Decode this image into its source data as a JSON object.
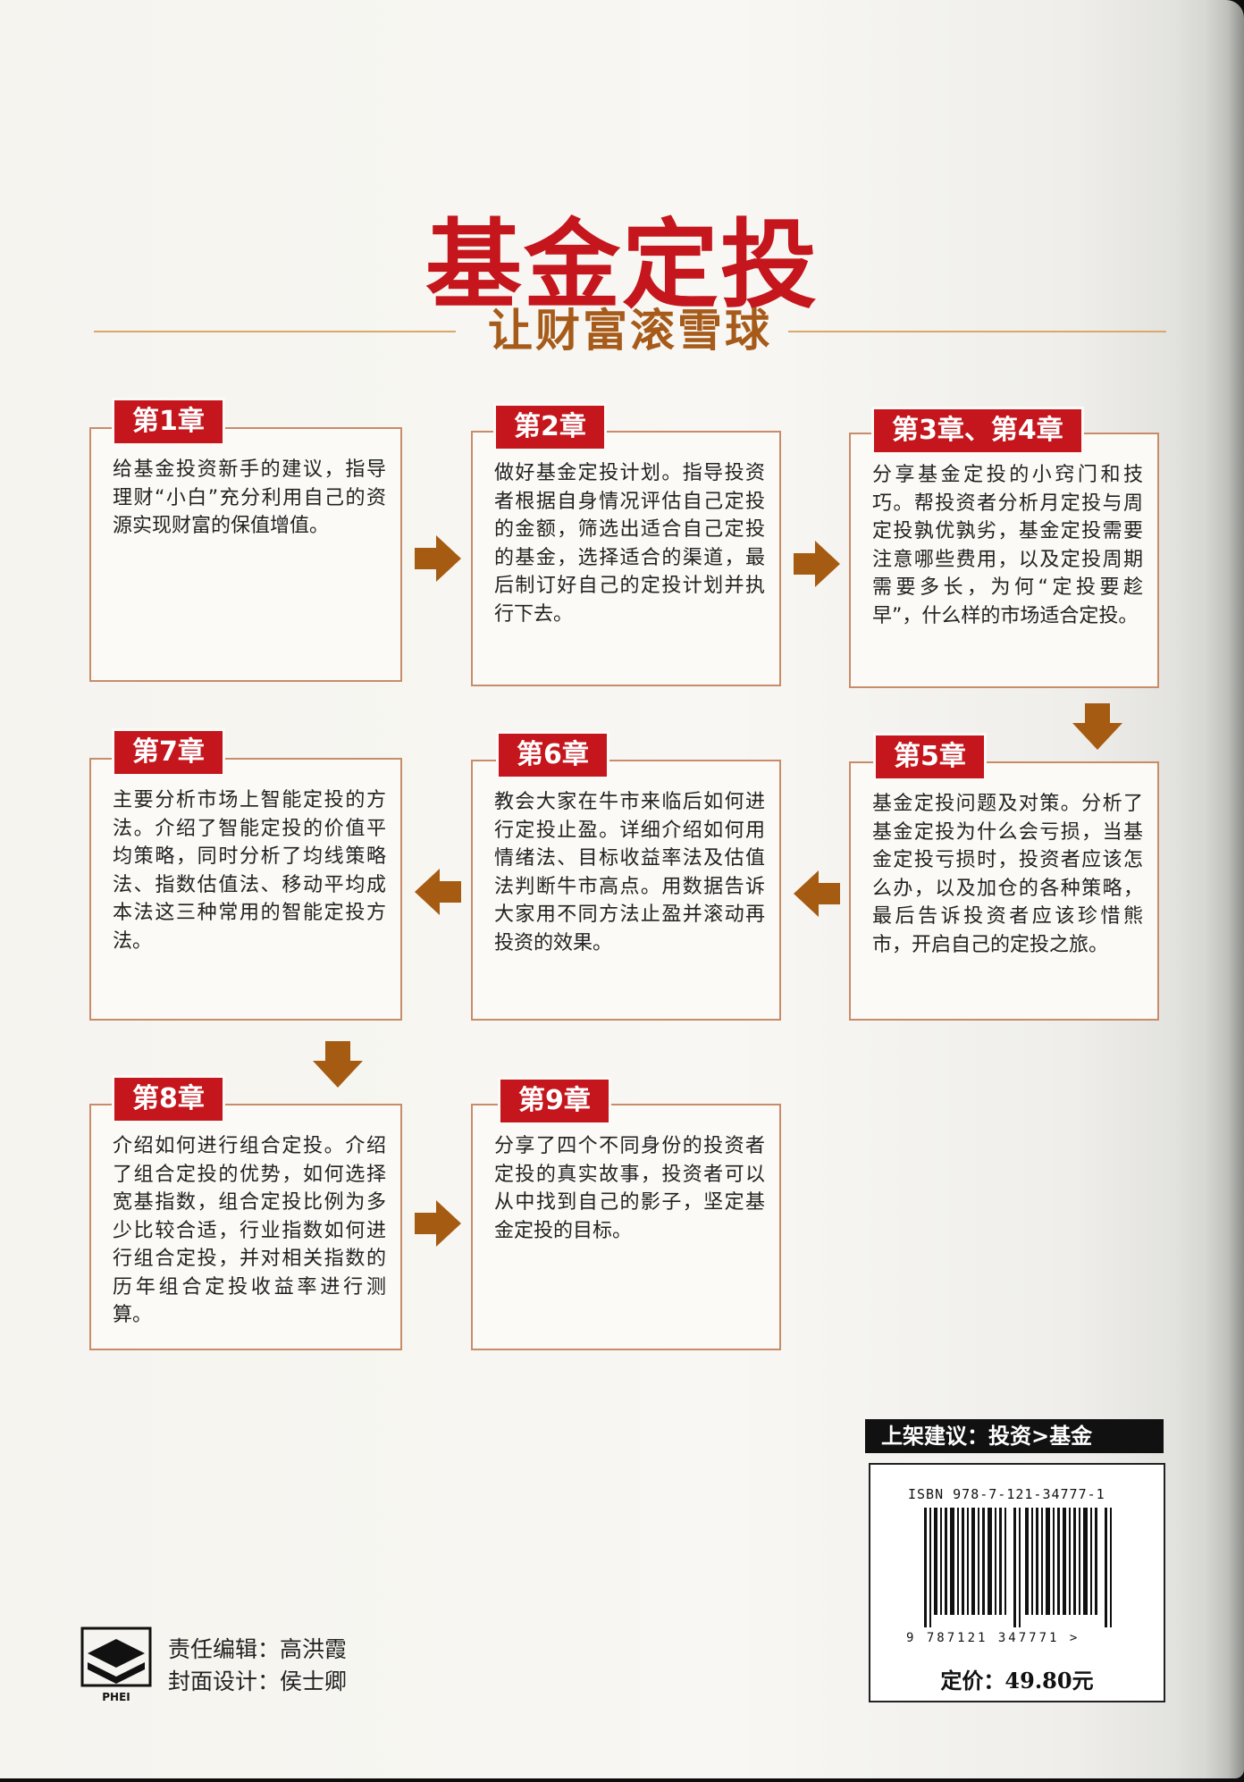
{
  "title": "基金定投",
  "subtitle": "让财富滚雪球",
  "chapters": [
    {
      "tag": "第1章",
      "text": "给基金投资新手的建议，指导理财“小白”充分利用自己的资源实现财富的保值增值。"
    },
    {
      "tag": "第2章",
      "text": "做好基金定投计划。指导投资者根据自身情况评估自己定投的金额，筛选出适合自己定投的基金，选择适合的渠道，最后制订好自己的定投计划并执行下去。"
    },
    {
      "tag": "第3章、第4章",
      "text": "分享基金定投的小窍门和技巧。帮投资者分析月定投与周定投孰优孰劣，基金定投需要注意哪些费用，以及定投周期需要多长，为何“定投要趁早”，什么样的市场适合定投。"
    },
    {
      "tag": "第5章",
      "text": "基金定投问题及对策。分析了基金定投为什么会亏损，当基金定投亏损时，投资者应该怎么办，以及加仓的各种策略，最后告诉投资者应该珍惜熊市，开启自己的定投之旅。"
    },
    {
      "tag": "第6章",
      "text": "教会大家在牛市来临后如何进行定投止盈。详细介绍如何用情绪法、目标收益率法及估值法判断牛市高点。用数据告诉大家用不同方法止盈并滚动再投资的效果。"
    },
    {
      "tag": "第7章",
      "text": "主要分析市场上智能定投的方法。介绍了智能定投的价值平均策略，同时分析了均线策略法、指数估值法、移动平均成本法这三种常用的智能定投方法。"
    },
    {
      "tag": "第8章",
      "text": "介绍如何进行组合定投。介绍了组合定投的优势，如何选择宽基指数，组合定投比例为多少比较合适，行业指数如何进行组合定投，并对相关指数的历年组合定投收益率进行测算。"
    },
    {
      "tag": "第9章",
      "text": "分享了四个不同身份的投资者定投的真实故事，投资者可以从中找到自己的影子，坚定基金定投的目标。"
    }
  ],
  "shelf_label": "上架建议：投资>基金",
  "isbn": "ISBN 978-7-121-34777-1",
  "barcode_digits": "9 787121 347771 >",
  "price": "定价：49.80元",
  "publisher_logo_text": "PHEI",
  "credits": {
    "editor": "责任编辑：高洪霞",
    "designer": "封面设计：侯士卿"
  },
  "colors": {
    "accent_red": "#c4161c",
    "arrow_brown": "#a65b12",
    "box_border": "#c98c6a"
  }
}
